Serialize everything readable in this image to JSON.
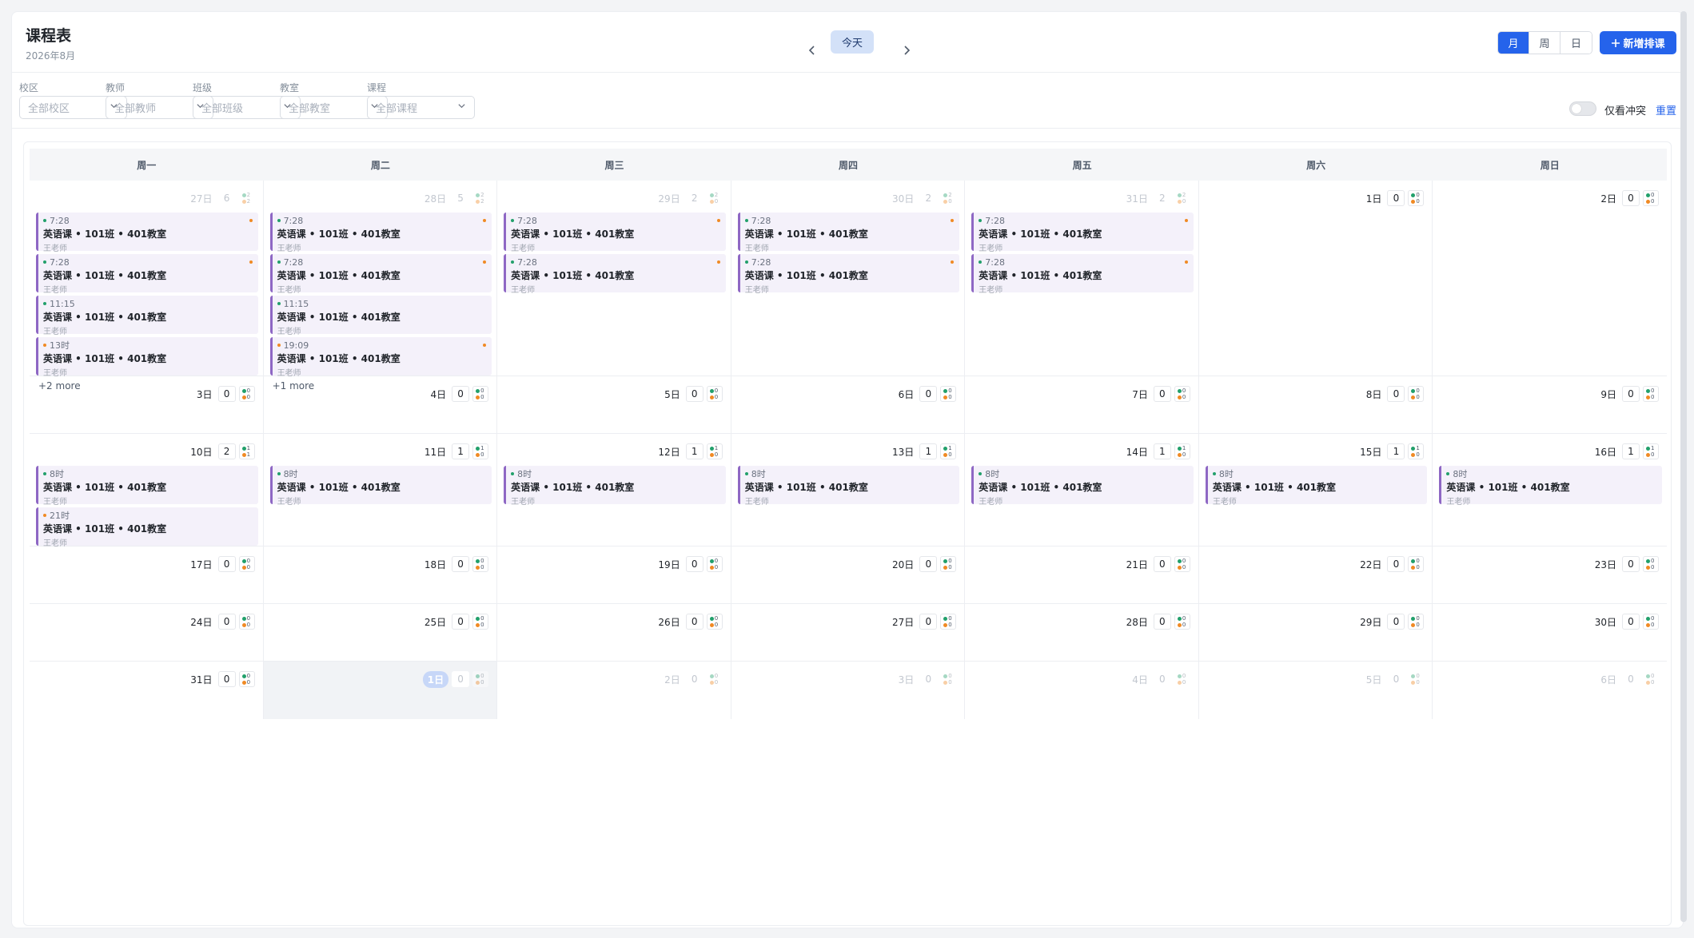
{
  "header": {
    "title": "课程表",
    "subtitle": "2026年8月",
    "today_label": "今天",
    "view_tabs": [
      {
        "label": "月",
        "active": true
      },
      {
        "label": "周",
        "active": false
      },
      {
        "label": "日",
        "active": false
      }
    ],
    "add_label": "新增排课",
    "accent": "#2563eb"
  },
  "filters": {
    "items": [
      {
        "label": "校区",
        "placeholder": "全部校区"
      },
      {
        "label": "教师",
        "placeholder": "全部教师"
      },
      {
        "label": "班级",
        "placeholder": "全部班级"
      },
      {
        "label": "教室",
        "placeholder": "全部教室"
      },
      {
        "label": "课程",
        "placeholder": "全部课程"
      }
    ],
    "conflict_toggle_label": "仅看冲突",
    "conflict_toggle_on": false,
    "reset_label": "重置"
  },
  "calendar": {
    "weekdays": [
      "周一",
      "周二",
      "周三",
      "周四",
      "周五",
      "周六",
      "周日"
    ],
    "weeks": [
      {
        "days": [
          {
            "label": "27日",
            "count": "6",
            "other": true,
            "mini": [
              "2",
              "2"
            ],
            "events": [
              {
                "time": "7:28",
                "title": "英语课 • 101班 • 401教室",
                "teacher": "王老师",
                "dot": "green",
                "flag": true
              },
              {
                "time": "7:28",
                "title": "英语课 • 101班 • 401教室",
                "teacher": "王老师",
                "dot": "green",
                "flag": true
              },
              {
                "time": "11:15",
                "title": "英语课 • 101班 • 401教室",
                "teacher": "王老师",
                "dot": "green",
                "flag": false
              },
              {
                "time": "13时",
                "title": "英语课 • 101班 • 401教室",
                "teacher": "王老师",
                "dot": "orange",
                "flag": false
              }
            ],
            "more": "+2 more"
          },
          {
            "label": "28日",
            "count": "5",
            "other": true,
            "mini": [
              "2",
              "2"
            ],
            "events": [
              {
                "time": "7:28",
                "title": "英语课 • 101班 • 401教室",
                "teacher": "王老师",
                "dot": "green",
                "flag": true
              },
              {
                "time": "7:28",
                "title": "英语课 • 101班 • 401教室",
                "teacher": "王老师",
                "dot": "green",
                "flag": true
              },
              {
                "time": "11:15",
                "title": "英语课 • 101班 • 401教室",
                "teacher": "王老师",
                "dot": "green",
                "flag": false
              },
              {
                "time": "19:09",
                "title": "英语课 • 101班 • 401教室",
                "teacher": "王老师",
                "dot": "orange",
                "flag": true
              }
            ],
            "more": "+1 more"
          },
          {
            "label": "29日",
            "count": "2",
            "other": true,
            "mini": [
              "2",
              "0"
            ],
            "events": [
              {
                "time": "7:28",
                "title": "英语课 • 101班 • 401教室",
                "teacher": "王老师",
                "dot": "green",
                "flag": true
              },
              {
                "time": "7:28",
                "title": "英语课 • 101班 • 401教室",
                "teacher": "王老师",
                "dot": "green",
                "flag": true
              }
            ]
          },
          {
            "label": "30日",
            "count": "2",
            "other": true,
            "mini": [
              "2",
              "0"
            ],
            "events": [
              {
                "time": "7:28",
                "title": "英语课 • 101班 • 401教室",
                "teacher": "王老师",
                "dot": "green",
                "flag": true
              },
              {
                "time": "7:28",
                "title": "英语课 • 101班 • 401教室",
                "teacher": "王老师",
                "dot": "green",
                "flag": true
              }
            ]
          },
          {
            "label": "31日",
            "count": "2",
            "other": true,
            "mini": [
              "2",
              "0"
            ],
            "events": [
              {
                "time": "7:28",
                "title": "英语课 • 101班 • 401教室",
                "teacher": "王老师",
                "dot": "green",
                "flag": true
              },
              {
                "time": "7:28",
                "title": "英语课 • 101班 • 401教室",
                "teacher": "王老师",
                "dot": "green",
                "flag": true
              }
            ]
          },
          {
            "label": "1日",
            "count": "0",
            "mini": [
              "0",
              "0"
            ],
            "events": []
          },
          {
            "label": "2日",
            "count": "0",
            "mini": [
              "0",
              "0"
            ],
            "events": []
          }
        ]
      },
      {
        "days": [
          {
            "label": "3日",
            "count": "0",
            "mini": [
              "0",
              "0"
            ],
            "events": []
          },
          {
            "label": "4日",
            "count": "0",
            "mini": [
              "0",
              "0"
            ],
            "events": []
          },
          {
            "label": "5日",
            "count": "0",
            "mini": [
              "0",
              "0"
            ],
            "events": []
          },
          {
            "label": "6日",
            "count": "0",
            "mini": [
              "0",
              "0"
            ],
            "events": []
          },
          {
            "label": "7日",
            "count": "0",
            "mini": [
              "0",
              "0"
            ],
            "events": []
          },
          {
            "label": "8日",
            "count": "0",
            "mini": [
              "0",
              "0"
            ],
            "events": []
          },
          {
            "label": "9日",
            "count": "0",
            "mini": [
              "0",
              "0"
            ],
            "events": []
          }
        ]
      },
      {
        "days": [
          {
            "label": "10日",
            "count": "2",
            "mini": [
              "1",
              "1"
            ],
            "events": [
              {
                "time": "8时",
                "title": "英语课 • 101班 • 401教室",
                "teacher": "王老师",
                "dot": "green",
                "flag": false
              },
              {
                "time": "21时",
                "title": "英语课 • 101班 • 401教室",
                "teacher": "王老师",
                "dot": "orange",
                "flag": false
              }
            ]
          },
          {
            "label": "11日",
            "count": "1",
            "mini": [
              "1",
              "0"
            ],
            "events": [
              {
                "time": "8时",
                "title": "英语课 • 101班 • 401教室",
                "teacher": "王老师",
                "dot": "green",
                "flag": false
              }
            ]
          },
          {
            "label": "12日",
            "count": "1",
            "mini": [
              "1",
              "0"
            ],
            "events": [
              {
                "time": "8时",
                "title": "英语课 • 101班 • 401教室",
                "teacher": "王老师",
                "dot": "green",
                "flag": false
              }
            ]
          },
          {
            "label": "13日",
            "count": "1",
            "mini": [
              "1",
              "0"
            ],
            "events": [
              {
                "time": "8时",
                "title": "英语课 • 101班 • 401教室",
                "teacher": "王老师",
                "dot": "green",
                "flag": false
              }
            ]
          },
          {
            "label": "14日",
            "count": "1",
            "mini": [
              "1",
              "0"
            ],
            "events": [
              {
                "time": "8时",
                "title": "英语课 • 101班 • 401教室",
                "teacher": "王老师",
                "dot": "green",
                "flag": false
              }
            ]
          },
          {
            "label": "15日",
            "count": "1",
            "mini": [
              "1",
              "0"
            ],
            "events": [
              {
                "time": "8时",
                "title": "英语课 • 101班 • 401教室",
                "teacher": "王老师",
                "dot": "green",
                "flag": false
              }
            ]
          },
          {
            "label": "16日",
            "count": "1",
            "mini": [
              "1",
              "0"
            ],
            "events": [
              {
                "time": "8时",
                "title": "英语课 • 101班 • 401教室",
                "teacher": "王老师",
                "dot": "green",
                "flag": false
              }
            ]
          }
        ]
      },
      {
        "days": [
          {
            "label": "17日",
            "count": "0",
            "mini": [
              "0",
              "0"
            ],
            "events": []
          },
          {
            "label": "18日",
            "count": "0",
            "mini": [
              "0",
              "0"
            ],
            "events": []
          },
          {
            "label": "19日",
            "count": "0",
            "mini": [
              "0",
              "0"
            ],
            "events": []
          },
          {
            "label": "20日",
            "count": "0",
            "mini": [
              "0",
              "0"
            ],
            "events": []
          },
          {
            "label": "21日",
            "count": "0",
            "mini": [
              "0",
              "0"
            ],
            "events": []
          },
          {
            "label": "22日",
            "count": "0",
            "mini": [
              "0",
              "0"
            ],
            "events": []
          },
          {
            "label": "23日",
            "count": "0",
            "mini": [
              "0",
              "0"
            ],
            "events": []
          }
        ]
      },
      {
        "days": [
          {
            "label": "24日",
            "count": "0",
            "mini": [
              "0",
              "0"
            ],
            "events": []
          },
          {
            "label": "25日",
            "count": "0",
            "mini": [
              "0",
              "0"
            ],
            "events": []
          },
          {
            "label": "26日",
            "count": "0",
            "mini": [
              "0",
              "0"
            ],
            "events": []
          },
          {
            "label": "27日",
            "count": "0",
            "mini": [
              "0",
              "0"
            ],
            "events": []
          },
          {
            "label": "28日",
            "count": "0",
            "mini": [
              "0",
              "0"
            ],
            "events": []
          },
          {
            "label": "29日",
            "count": "0",
            "mini": [
              "0",
              "0"
            ],
            "events": []
          },
          {
            "label": "30日",
            "count": "0",
            "mini": [
              "0",
              "0"
            ],
            "events": []
          }
        ]
      },
      {
        "days": [
          {
            "label": "31日",
            "count": "0",
            "mini": [
              "0",
              "0"
            ],
            "events": []
          },
          {
            "label": "1日",
            "count": "0",
            "other": true,
            "today": true,
            "mini": [
              "0",
              "0"
            ],
            "events": []
          },
          {
            "label": "2日",
            "count": "0",
            "other": true,
            "mini": [
              "0",
              "0"
            ],
            "events": []
          },
          {
            "label": "3日",
            "count": "0",
            "other": true,
            "mini": [
              "0",
              "0"
            ],
            "events": []
          },
          {
            "label": "4日",
            "count": "0",
            "other": true,
            "mini": [
              "0",
              "0"
            ],
            "events": []
          },
          {
            "label": "5日",
            "count": "0",
            "other": true,
            "mini": [
              "0",
              "0"
            ],
            "events": []
          },
          {
            "label": "6日",
            "count": "0",
            "other": true,
            "mini": [
              "0",
              "0"
            ],
            "events": []
          }
        ]
      }
    ]
  }
}
